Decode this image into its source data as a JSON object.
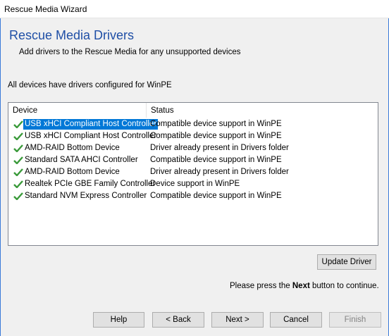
{
  "window": {
    "title": "Rescue Media Wizard"
  },
  "page": {
    "title": "Rescue Media Drivers",
    "subtitle": "Add drivers to the Rescue Media for any unsupported devices",
    "status": "All devices have drivers configured for WinPE"
  },
  "device_list": {
    "columns": [
      "Device",
      "Status"
    ],
    "rows": [
      {
        "device": "USB xHCI Compliant Host Controller",
        "status": "Compatible device support in WinPE",
        "selected": true
      },
      {
        "device": "USB xHCI Compliant Host Controller",
        "status": "Compatible device support in WinPE"
      },
      {
        "device": "AMD-RAID Bottom Device",
        "status": "Driver already present in Drivers folder"
      },
      {
        "device": "Standard SATA AHCI Controller",
        "status": "Compatible device support in WinPE"
      },
      {
        "device": "AMD-RAID Bottom Device",
        "status": "Driver already present in Drivers folder"
      },
      {
        "device": "Realtek PCIe GBE Family Controller",
        "status": "Device support in WinPE"
      },
      {
        "device": "Standard NVM Express Controller",
        "status": "Compatible device support in WinPE"
      }
    ],
    "row_icon": "green-checkmark-icon"
  },
  "buttons": {
    "update_driver": "Update Driver",
    "help": "Help",
    "back": "< Back",
    "next": "Next >",
    "cancel": "Cancel",
    "finish": "Finish"
  },
  "hint": {
    "before": "Please press the",
    "keyword": "Next",
    "after": "button to continue."
  },
  "colors": {
    "title": "#1f4fa6",
    "selection": "#0078d7",
    "check": "#3a9a3a"
  }
}
